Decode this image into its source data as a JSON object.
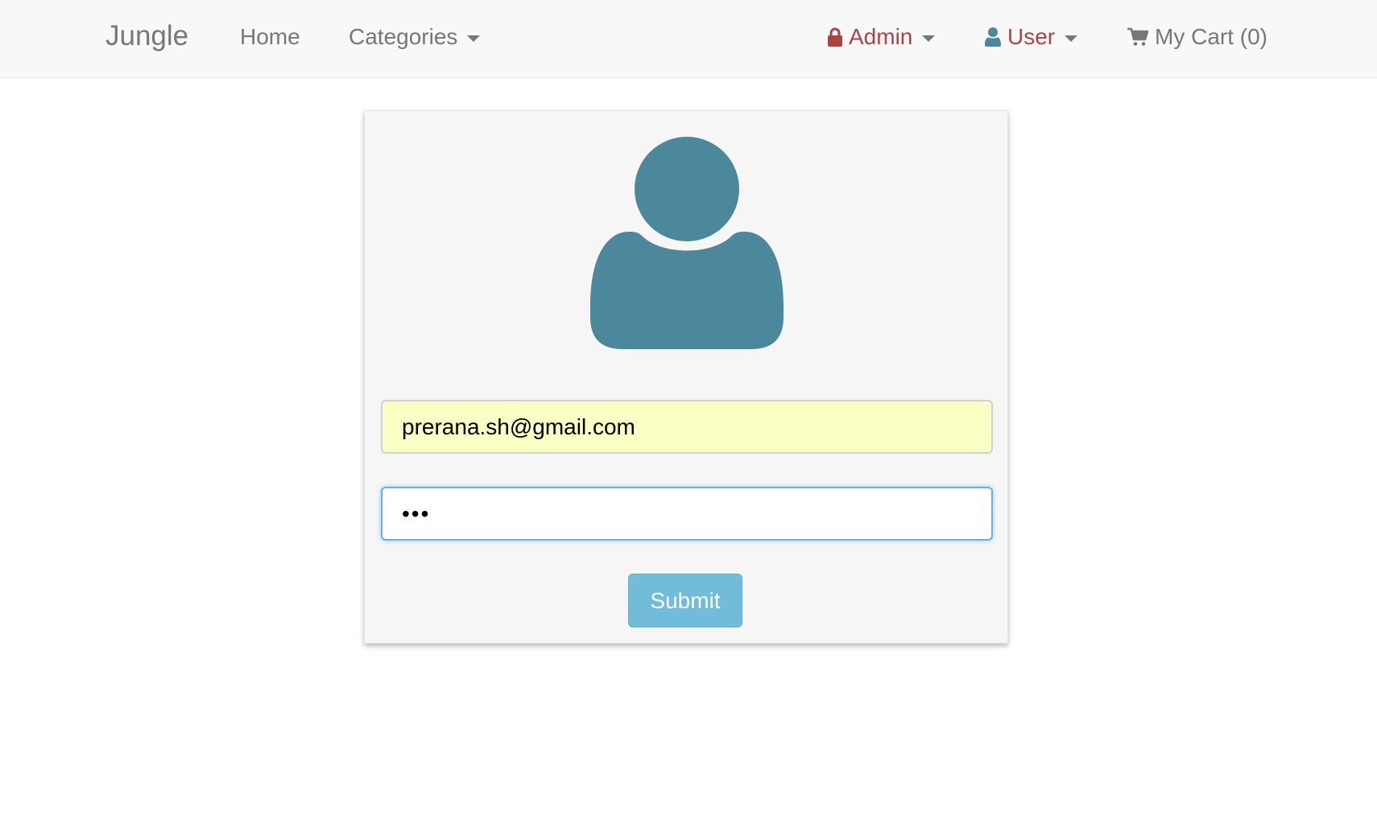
{
  "navbar": {
    "brand": "Jungle",
    "home": "Home",
    "categories": "Categories",
    "admin": "Admin",
    "user": "User",
    "cart": "My Cart (0)"
  },
  "icons": {
    "admin": "lock-icon",
    "user": "user-icon",
    "cart": "shopping-cart-icon",
    "avatar": "user-avatar-icon"
  },
  "colors": {
    "navbar_bg": "#f8f8f8",
    "nav_text": "#777777",
    "admin_user_text": "#a94442",
    "user_icon": "#4b889b",
    "avatar": "#4b889b",
    "email_autofill_bg": "#faffc4",
    "focus_border": "#66afe9",
    "submit_bg": "#70bcd9"
  },
  "login": {
    "email_value": "prerana.sh@gmail.com",
    "password_value": "•••",
    "submit_label": "Submit"
  }
}
